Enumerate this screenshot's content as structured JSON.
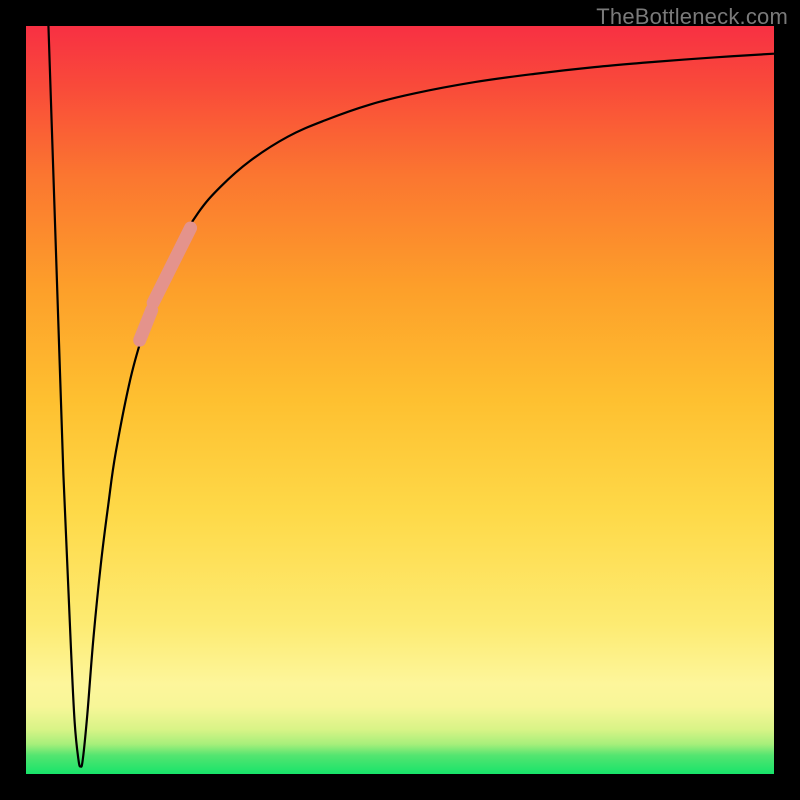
{
  "watermark": "TheBottleneck.com",
  "colors": {
    "frame": "#000000",
    "curve": "#000000",
    "marker": "#e4938c"
  },
  "chart_data": {
    "type": "line",
    "title": "",
    "xlabel": "",
    "ylabel": "",
    "xlim": [
      0,
      100
    ],
    "ylim": [
      0,
      100
    ],
    "grid": false,
    "legend": false,
    "series": [
      {
        "name": "main-curve",
        "x": [
          3,
          4,
          5,
          6,
          6.5,
          7,
          7.3,
          7.6,
          8.2,
          9,
          10,
          11,
          12,
          14,
          16,
          18,
          20,
          23,
          26,
          30,
          35,
          40,
          46,
          52,
          60,
          68,
          76,
          84,
          92,
          100
        ],
        "y": [
          100,
          70,
          40,
          17,
          7,
          2,
          1,
          2,
          8,
          18,
          28,
          36,
          43,
          53,
          60,
          65.5,
          70,
          75,
          78.5,
          82,
          85.2,
          87.4,
          89.5,
          91,
          92.5,
          93.6,
          94.5,
          95.2,
          95.8,
          96.3
        ]
      }
    ],
    "markers": [
      {
        "name": "segment-upper",
        "x_range": [
          17,
          22
        ],
        "y_range": [
          63,
          73
        ],
        "shape": "pill"
      },
      {
        "name": "segment-lower",
        "x_range": [
          15.2,
          16.8
        ],
        "y_range": [
          58,
          62
        ],
        "shape": "pill"
      }
    ],
    "background_gradient": {
      "direction": "vertical",
      "stops": [
        {
          "pos": 0.0,
          "color": "#17e36a"
        },
        {
          "pos": 0.06,
          "color": "#d9f487"
        },
        {
          "pos": 0.12,
          "color": "#fdf69b"
        },
        {
          "pos": 0.35,
          "color": "#fed948"
        },
        {
          "pos": 0.65,
          "color": "#fd9f2a"
        },
        {
          "pos": 0.92,
          "color": "#f94a3a"
        },
        {
          "pos": 1.0,
          "color": "#f83043"
        }
      ]
    }
  }
}
